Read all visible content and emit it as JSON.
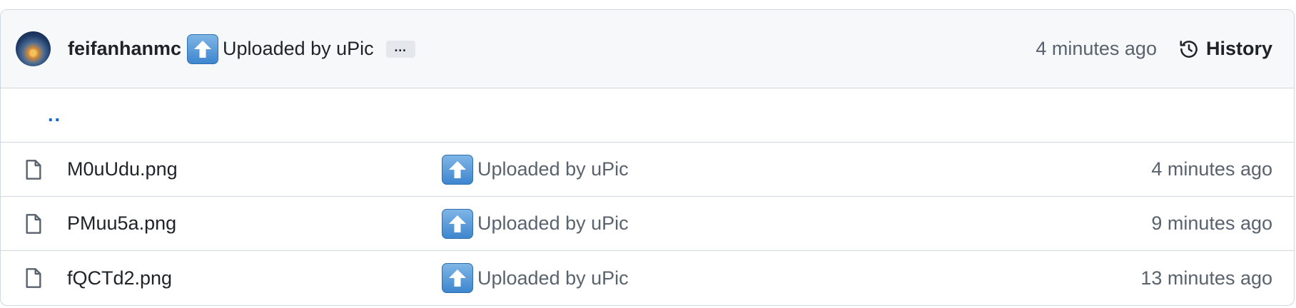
{
  "commit": {
    "author": "feifanhanmc",
    "emoji": "up-arrow-emoji",
    "message": "Uploaded by uPic",
    "ellipsis": "…",
    "time": "4 minutes ago",
    "history_label": "History"
  },
  "parent_dir": "..",
  "files": [
    {
      "name": "M0uUdu.png",
      "message": "Uploaded by uPic",
      "time": "4 minutes ago"
    },
    {
      "name": "PMuu5a.png",
      "message": "Uploaded by uPic",
      "time": "9 minutes ago"
    },
    {
      "name": "fQCTd2.png",
      "message": "Uploaded by uPic",
      "time": "13 minutes ago"
    }
  ],
  "colors": {
    "link": "#0969da",
    "muted": "#59636e",
    "border": "#d0d7de",
    "header_bg": "#f6f8fa"
  }
}
